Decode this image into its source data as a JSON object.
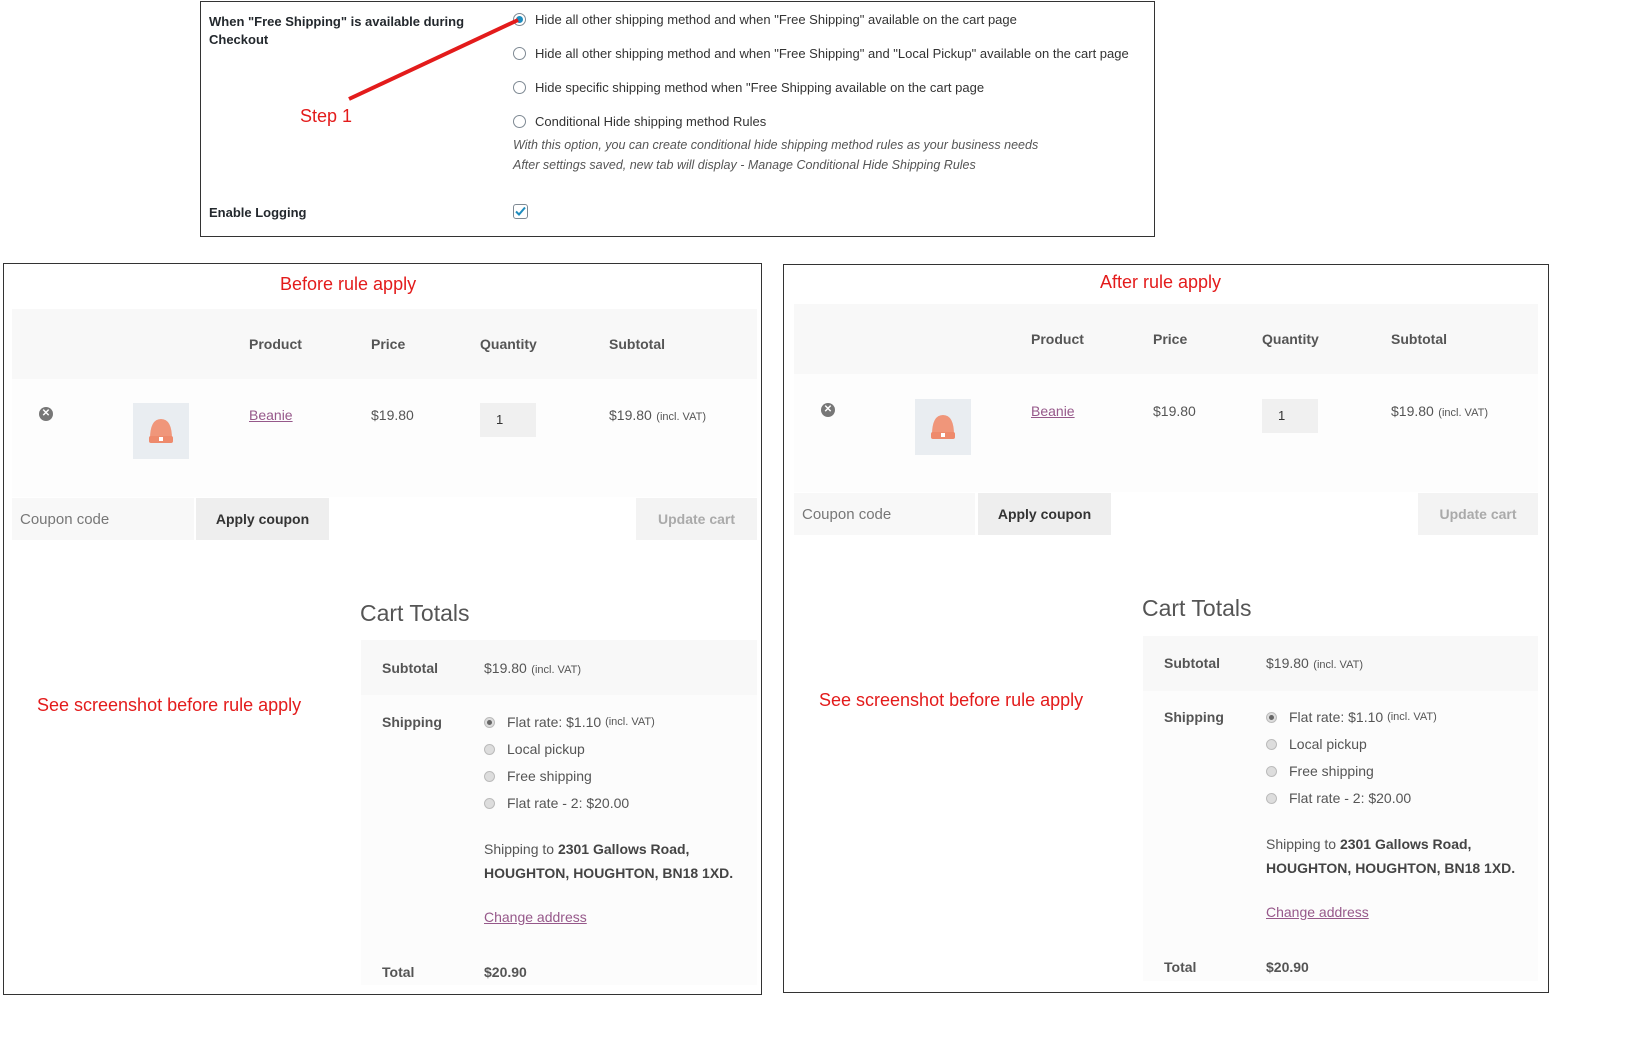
{
  "settings": {
    "label": "When \"Free Shipping\" is available during Checkout",
    "options": [
      {
        "label": "Hide all other shipping method and when \"Free Shipping\" available on the cart page",
        "checked": true
      },
      {
        "label": "Hide all other shipping method and when \"Free Shipping\" and \"Local Pickup\" available on the cart page",
        "checked": false
      },
      {
        "label": "Hide specific shipping method when \"Free Shipping available on the cart page",
        "checked": false
      },
      {
        "label": "Conditional Hide shipping method Rules",
        "checked": false
      }
    ],
    "desc1": "With this option, you can create conditional hide shipping method rules as your business needs",
    "desc2": "After settings saved, new tab will display - Manage Conditional Hide Shipping Rules",
    "logging_label": "Enable Logging",
    "logging_checked": true
  },
  "annotations": {
    "step1": "Step 1",
    "before_title": "Before rule apply",
    "after_title": "After rule apply",
    "before_note": "See screenshot before rule apply",
    "after_note": "See screenshot before rule apply"
  },
  "colors": {
    "annotation": "#e31b1b",
    "link": "#96588a",
    "radio_accent": "#1e8cbe"
  },
  "cart": {
    "headers": {
      "product": "Product",
      "price": "Price",
      "quantity": "Quantity",
      "subtotal": "Subtotal"
    },
    "item": {
      "name": "Beanie",
      "price": "$19.80",
      "qty": "1",
      "subtotal": "$19.80",
      "vat": "(incl. VAT)"
    },
    "coupon_placeholder": "Coupon code",
    "apply_coupon": "Apply coupon",
    "update_cart": "Update cart"
  },
  "totals": {
    "title": "Cart Totals",
    "subtotal_label": "Subtotal",
    "subtotal_value": "$19.80",
    "vat": "(incl. VAT)",
    "shipping_label": "Shipping",
    "shipping_options": [
      {
        "label": "Flat rate: $1.10",
        "vat": "(incl. VAT)",
        "selected": true
      },
      {
        "label": "Local pickup",
        "vat": "",
        "selected": false
      },
      {
        "label": "Free shipping",
        "vat": "",
        "selected": false
      },
      {
        "label": "Flat rate - 2: $20.00",
        "vat": "",
        "selected": false
      }
    ],
    "shipping_to": "Shipping to",
    "address_line1": "2301 Gallows Road,",
    "address_line2": "HOUGHTON, HOUGHTON, BN18 1XD.",
    "change_address": "Change address",
    "total_label": "Total",
    "total_value": "$20.90"
  }
}
